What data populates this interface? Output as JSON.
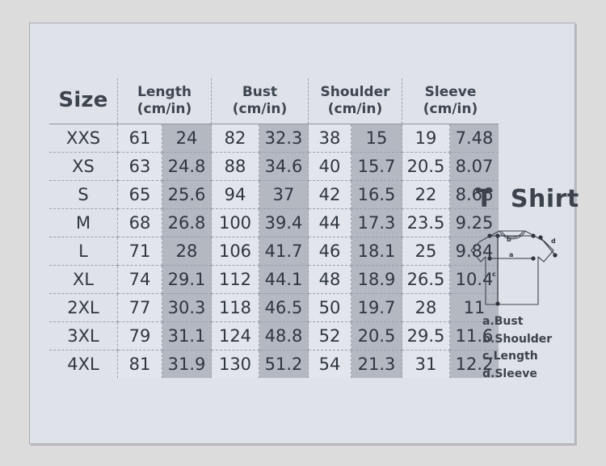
{
  "panel": {
    "background": "#dfe2e8",
    "border_color": "#a9adb4"
  },
  "table": {
    "size_header": "Size",
    "columns": [
      {
        "name": "Length",
        "unit": "(cm/in)"
      },
      {
        "name": "Bust",
        "unit": "(cm/in)"
      },
      {
        "name": "Shoulder",
        "unit": "(cm/in)"
      },
      {
        "name": "Sleeve",
        "unit": "(cm/in)"
      }
    ],
    "rows": [
      {
        "size": "XXS",
        "length_cm": "61",
        "length_in": "24",
        "bust_cm": "82",
        "bust_in": "32.3",
        "shoulder_cm": "38",
        "shoulder_in": "15",
        "sleeve_cm": "19",
        "sleeve_in": "7.48"
      },
      {
        "size": "XS",
        "length_cm": "63",
        "length_in": "24.8",
        "bust_cm": "88",
        "bust_in": "34.6",
        "shoulder_cm": "40",
        "shoulder_in": "15.7",
        "sleeve_cm": "20.5",
        "sleeve_in": "8.07"
      },
      {
        "size": "S",
        "length_cm": "65",
        "length_in": "25.6",
        "bust_cm": "94",
        "bust_in": "37",
        "shoulder_cm": "42",
        "shoulder_in": "16.5",
        "sleeve_cm": "22",
        "sleeve_in": "8.66"
      },
      {
        "size": "M",
        "length_cm": "68",
        "length_in": "26.8",
        "bust_cm": "100",
        "bust_in": "39.4",
        "shoulder_cm": "44",
        "shoulder_in": "17.3",
        "sleeve_cm": "23.5",
        "sleeve_in": "9.25"
      },
      {
        "size": "L",
        "length_cm": "71",
        "length_in": "28",
        "bust_cm": "106",
        "bust_in": "41.7",
        "shoulder_cm": "46",
        "shoulder_in": "18.1",
        "sleeve_cm": "25",
        "sleeve_in": "9.84"
      },
      {
        "size": "XL",
        "length_cm": "74",
        "length_in": "29.1",
        "bust_cm": "112",
        "bust_in": "44.1",
        "shoulder_cm": "48",
        "shoulder_in": "18.9",
        "sleeve_cm": "26.5",
        "sleeve_in": "10.4"
      },
      {
        "size": "2XL",
        "length_cm": "77",
        "length_in": "30.3",
        "bust_cm": "118",
        "bust_in": "46.5",
        "shoulder_cm": "50",
        "shoulder_in": "19.7",
        "sleeve_cm": "28",
        "sleeve_in": "11"
      },
      {
        "size": "3XL",
        "length_cm": "79",
        "length_in": "31.1",
        "bust_cm": "124",
        "bust_in": "48.8",
        "shoulder_cm": "52",
        "shoulder_in": "20.5",
        "sleeve_cm": "29.5",
        "sleeve_in": "11.6"
      },
      {
        "size": "4XL",
        "length_cm": "81",
        "length_in": "31.9",
        "bust_cm": "130",
        "bust_in": "51.2",
        "shoulder_cm": "54",
        "shoulder_in": "21.3",
        "sleeve_cm": "31",
        "sleeve_in": "12.2"
      }
    ]
  },
  "illustration": {
    "title": "T  Shirt",
    "markers": {
      "bust": "a",
      "shoulder": "b",
      "length": "c",
      "sleeve": "d"
    },
    "legend": [
      "a.Bust",
      "b.Shoulder",
      "c.Length",
      "d.Sleeve"
    ]
  }
}
